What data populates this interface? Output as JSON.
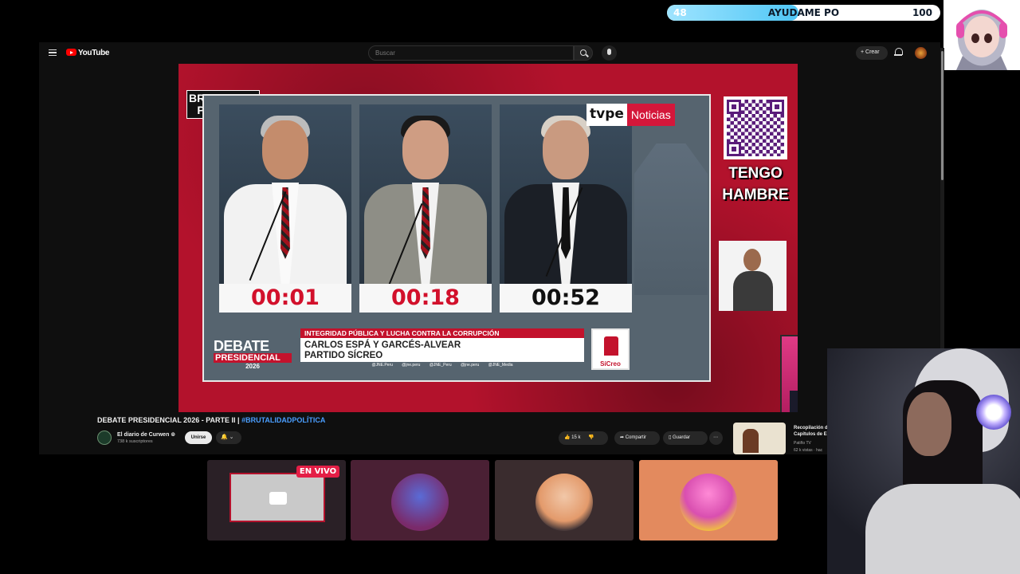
{
  "goal": {
    "start": "48",
    "title": "AYUDAME PO",
    "end": "100",
    "progress_fraction": 0.48
  },
  "youtube": {
    "brand": "YouTube",
    "search_placeholder": "Buscar",
    "create_label": "+ Crear"
  },
  "broadcast": {
    "show_badge": "BRUTALIDAD POLÍTICA",
    "channel_logo_a": "tvpe",
    "channel_logo_b": "Noticias",
    "timers": [
      "00:01",
      "00:18",
      "00:52"
    ],
    "qr_caption": "TENGO HAMBRE",
    "lower_third": {
      "debate": "DEBATE",
      "presidencial": "PRESIDENCIAL",
      "year": "2026",
      "topic": "INTEGRIDAD PÚBLICA Y LUCHA CONTRA LA CORRUPCIÓN",
      "name_line_1": "CARLOS ESPÁ Y GARCÉS-ALVEAR",
      "name_line_2": "PARTIDO SÍCREO",
      "social": "@JNE.Peru @jne.peru @JNE_Peru @jne.peru @JNE_Media",
      "party_logo": "SíCreo"
    }
  },
  "video": {
    "title_main": "DEBATE PRESIDENCIAL 2026 - PARTE II |",
    "title_hashtag": "#BRUTALIDADPOLÍTICA",
    "channel_name": "El diario de Curwen ⊚",
    "subscribers": "738 k suscriptores",
    "join_label": "Unirse",
    "likes": "15 k",
    "share_label": "Compartir",
    "save_label": "Guardar",
    "related": {
      "title": "Recopilación de Capitulos de E",
      "channel": "Patiño TV",
      "views": "62 k vistas · hac"
    }
  },
  "live_badge": "EN VIVO",
  "colors": {
    "accent_red": "#b3122c",
    "goal_fill": "#4fc6f5",
    "live_red": "#e41e46"
  }
}
